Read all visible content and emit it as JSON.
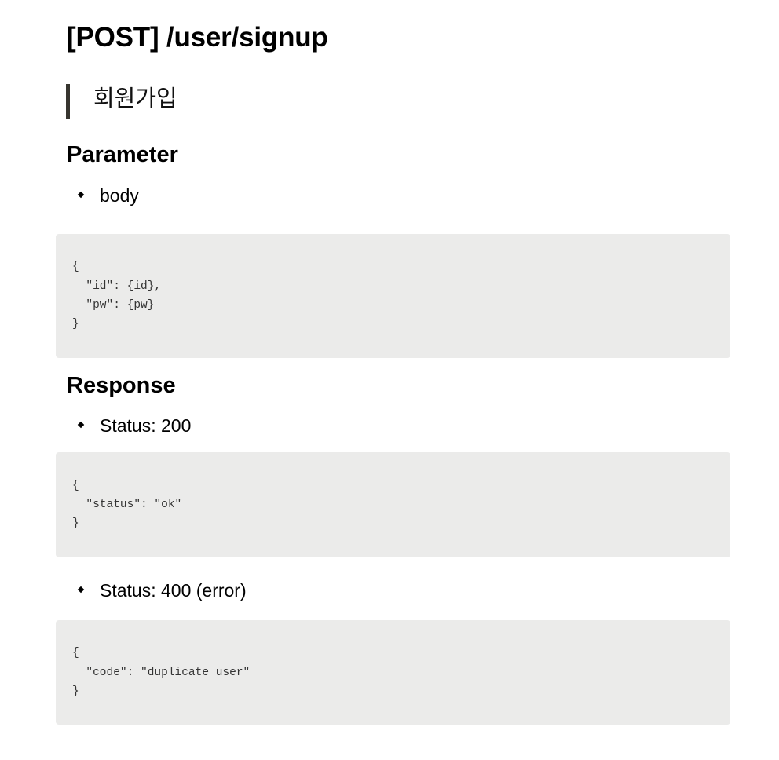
{
  "doc": {
    "title": "[POST] /user/signup",
    "quote": "회원가입",
    "parameter": {
      "heading": "Parameter",
      "bullet": "body",
      "code": [
        "{",
        "  \"id\": {id},",
        "  \"pw\": {pw}",
        "}"
      ]
    },
    "response": {
      "heading": "Response",
      "ok": {
        "bullet": "Status: 200",
        "code": [
          "{",
          "  \"status\": \"ok\"",
          "}"
        ]
      },
      "error": {
        "bullet": "Status: 400 (error)",
        "code": [
          "{",
          "  \"code\": \"duplicate user\"",
          "}"
        ]
      }
    }
  }
}
